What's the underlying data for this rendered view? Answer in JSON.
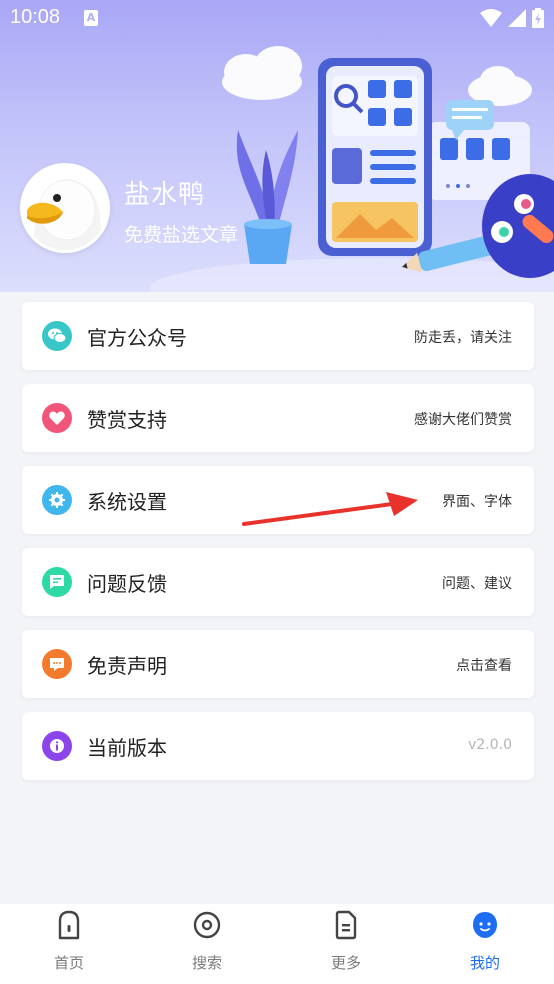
{
  "status_bar": {
    "time": "10:08",
    "notification_glyph": "A"
  },
  "profile": {
    "name": "盐水鸭",
    "subtitle": "免费盐选文章"
  },
  "menu": [
    {
      "label": "官方公众号",
      "hint": "防走丢，请关注",
      "icon": "wechat-icon",
      "color": "#38c6c9"
    },
    {
      "label": "赞赏支持",
      "hint": "感谢大佬们赞赏",
      "icon": "heart-icon",
      "color": "#f2557a"
    },
    {
      "label": "系统设置",
      "hint": "界面、字体",
      "icon": "gear-icon",
      "color": "#3fb6ee"
    },
    {
      "label": "问题反馈",
      "hint": "问题、建议",
      "icon": "message-icon",
      "color": "#2ddaa6"
    },
    {
      "label": "免责声明",
      "hint": "点击查看",
      "icon": "chat-icon",
      "color": "#f47a2d"
    },
    {
      "label": "当前版本",
      "hint": "v2.0.0",
      "icon": "info-icon",
      "color": "#8b45e9"
    }
  ],
  "nav": [
    {
      "label": "首页",
      "icon": "home-icon",
      "active": false
    },
    {
      "label": "搜索",
      "icon": "search-icon",
      "active": false
    },
    {
      "label": "更多",
      "icon": "more-icon",
      "active": false
    },
    {
      "label": "我的",
      "icon": "profile-icon",
      "active": true
    }
  ],
  "colors": {
    "accent": "#1f6df2",
    "arrow": "#e8332c",
    "header_top": "#a9a7f6"
  }
}
